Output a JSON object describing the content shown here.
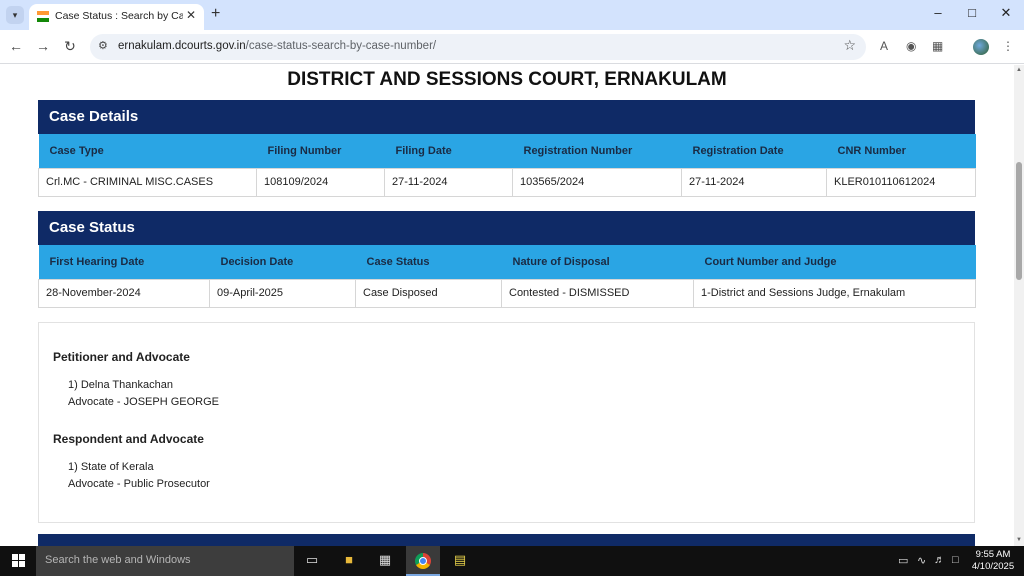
{
  "browser": {
    "tab_title": "Case Status : Search by Case Nu",
    "url_domain": "ernakulam.dcourts.gov.in",
    "url_path": "/case-status-search-by-case-number/"
  },
  "page": {
    "court_title": "DISTRICT AND SESSIONS COURT, ERNAKULAM"
  },
  "case_details": {
    "heading": "Case Details",
    "headers": [
      "Case Type",
      "Filing Number",
      "Filing Date",
      "Registration Number",
      "Registration Date",
      "CNR Number"
    ],
    "row": [
      "Crl.MC - CRIMINAL MISC.CASES",
      "108109/2024",
      "27-11-2024",
      "103565/2024",
      "27-11-2024",
      "KLER010110612024"
    ]
  },
  "case_status": {
    "heading": "Case Status",
    "headers": [
      "First Hearing Date",
      "Decision Date",
      "Case Status",
      "Nature of Disposal",
      "Court Number and Judge"
    ],
    "row": [
      "28-November-2024",
      "09-April-2025",
      "Case Disposed",
      "Contested - DISMISSED",
      "1-District and Sessions Judge, Ernakulam"
    ]
  },
  "parties": {
    "petitioner_heading": "Petitioner and Advocate",
    "petitioner_name": "1) Delna Thankachan",
    "petitioner_advocate": "Advocate - JOSEPH GEORGE",
    "respondent_heading": "Respondent and Advocate",
    "respondent_name": "1) State of Kerala",
    "respondent_advocate": "Advocate - Public Prosecutor"
  },
  "taskbar": {
    "search_placeholder": "Search the web and Windows",
    "time": "9:55 AM",
    "date": "4/10/2025"
  }
}
